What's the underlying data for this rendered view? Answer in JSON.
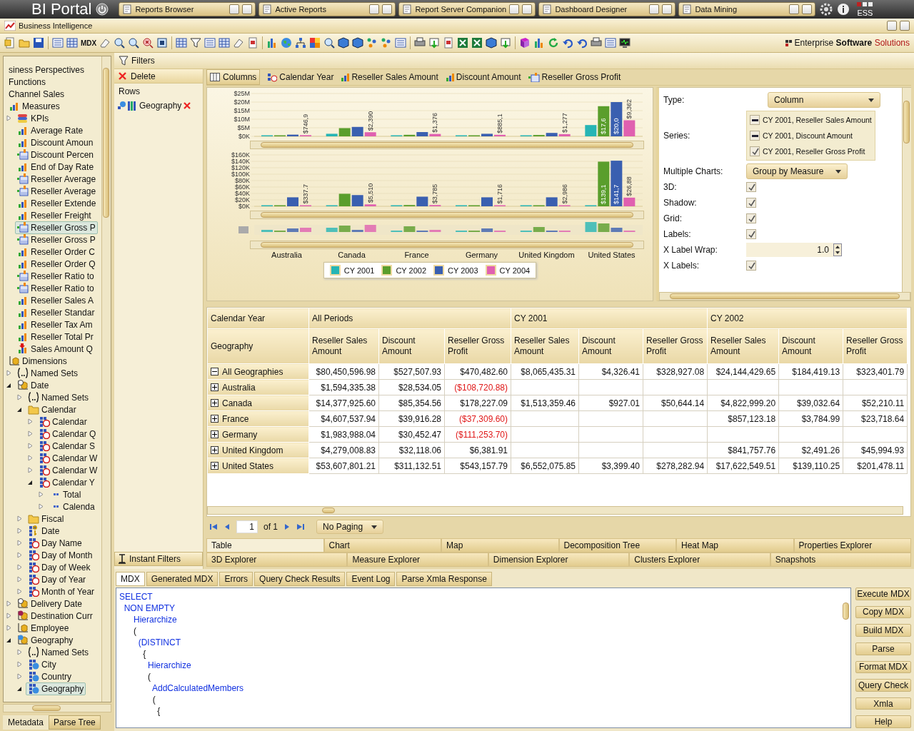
{
  "app_bar": {
    "title": "BI Portal",
    "logo": "ESS",
    "tabs": [
      {
        "label": "Reports Browser",
        "selected": false
      },
      {
        "label": "Active Reports",
        "selected": false
      },
      {
        "label": "Report Server Companion",
        "selected": false
      },
      {
        "label": "Dashboard Designer",
        "selected": false
      },
      {
        "label": "Data Mining",
        "selected": false
      }
    ]
  },
  "module": {
    "title": "Business Intelligence"
  },
  "toolbar": {
    "text_button": "MDX"
  },
  "tagline": [
    "Enterprise",
    "Software",
    "Solutions"
  ],
  "tree": [
    {
      "label": "siness Perspectives",
      "kind": "plain",
      "selected": false
    },
    {
      "label": "Functions",
      "kind": "plain",
      "selected": false
    },
    {
      "label": "Channel Sales",
      "kind": "plain",
      "selected": false
    },
    {
      "label": "Measures",
      "kind": "measures",
      "selected": false,
      "children": [
        {
          "label": "KPIs",
          "kind": "kpi",
          "selected": false,
          "expanded": false
        },
        {
          "label": "Average Rate",
          "kind": "measure",
          "selected": false
        },
        {
          "label": "Discount Amoun",
          "kind": "measure",
          "selected": false
        },
        {
          "label": "Discount Percen",
          "kind": "calc",
          "selected": false
        },
        {
          "label": "End of Day Rate",
          "kind": "measure",
          "selected": false
        },
        {
          "label": "Reseller Average",
          "kind": "calc",
          "selected": false
        },
        {
          "label": "Reseller Average",
          "kind": "calc",
          "selected": false
        },
        {
          "label": "Reseller Extende",
          "kind": "measure",
          "selected": false
        },
        {
          "label": "Reseller Freight",
          "kind": "measure",
          "selected": false
        },
        {
          "label": "Reseller Gross P",
          "kind": "calc",
          "selected": true
        },
        {
          "label": "Reseller Gross P",
          "kind": "calc",
          "selected": false
        },
        {
          "label": "Reseller Order C",
          "kind": "measure",
          "selected": false
        },
        {
          "label": "Reseller Order Q",
          "kind": "measure",
          "selected": false
        },
        {
          "label": "Reseller Ratio to",
          "kind": "calc",
          "selected": false
        },
        {
          "label": "Reseller Ratio to",
          "kind": "calc",
          "selected": false
        },
        {
          "label": "Reseller Sales A",
          "kind": "measure",
          "selected": false
        },
        {
          "label": "Reseller Standar",
          "kind": "measure",
          "selected": false
        },
        {
          "label": "Reseller Tax Am",
          "kind": "measure",
          "selected": false
        },
        {
          "label": "Reseller Total Pr",
          "kind": "measure",
          "selected": false
        },
        {
          "label": "Sales Amount Q",
          "kind": "alert",
          "selected": false
        }
      ]
    },
    {
      "label": "Dimensions",
      "kind": "dimension",
      "selected": false,
      "children": [
        {
          "label": "Named Sets",
          "kind": "set",
          "selected": false,
          "expanded": false
        },
        {
          "label": "Date",
          "kind": "timedim",
          "selected": false,
          "expanded": true,
          "children": [
            {
              "label": "Named Sets",
              "kind": "set",
              "selected": false,
              "expanded": false
            },
            {
              "label": "Calendar",
              "kind": "folder",
              "selected": false,
              "expanded": true,
              "children": [
                {
                  "label": "Calendar",
                  "kind": "timehier",
                  "selected": false,
                  "expanded": false
                },
                {
                  "label": "Calendar Q",
                  "kind": "timehier",
                  "selected": false,
                  "expanded": false
                },
                {
                  "label": "Calendar S",
                  "kind": "timehier",
                  "selected": false,
                  "expanded": false
                },
                {
                  "label": "Calendar W",
                  "kind": "timehier",
                  "selected": false,
                  "expanded": false
                },
                {
                  "label": "Calendar W",
                  "kind": "timehier",
                  "selected": false,
                  "expanded": false
                },
                {
                  "label": "Calendar Y",
                  "kind": "timehier",
                  "selected": false,
                  "expanded": true,
                  "children": [
                    {
                      "label": "Total",
                      "kind": "level",
                      "selected": false,
                      "expanded": false
                    },
                    {
                      "label": "Calenda",
                      "kind": "level",
                      "selected": false,
                      "expanded": false
                    }
                  ]
                }
              ]
            },
            {
              "label": "Fiscal",
              "kind": "folder",
              "selected": false,
              "expanded": false
            },
            {
              "label": "Date",
              "kind": "key",
              "selected": false,
              "expanded": false
            },
            {
              "label": "Day Name",
              "kind": "timehier",
              "selected": false,
              "expanded": false
            },
            {
              "label": "Day of Month",
              "kind": "timehier",
              "selected": false,
              "expanded": false
            },
            {
              "label": "Day of Week",
              "kind": "timehier",
              "selected": false,
              "expanded": false
            },
            {
              "label": "Day of Year",
              "kind": "timehier",
              "selected": false,
              "expanded": false
            },
            {
              "label": "Month of Year",
              "kind": "timehier",
              "selected": false,
              "expanded": false
            }
          ]
        },
        {
          "label": "Delivery Date",
          "kind": "timedim",
          "selected": false,
          "expanded": false
        },
        {
          "label": "Destination Curr",
          "kind": "currencydim",
          "selected": false,
          "expanded": false
        },
        {
          "label": "Employee",
          "kind": "dimension",
          "selected": false,
          "expanded": false
        },
        {
          "label": "Geography",
          "kind": "geodim",
          "selected": false,
          "expanded": true,
          "children": [
            {
              "label": "Named Sets",
              "kind": "set",
              "selected": false,
              "expanded": false
            },
            {
              "label": "City",
              "kind": "geo",
              "selected": false,
              "expanded": false
            },
            {
              "label": "Country",
              "kind": "geo",
              "selected": false,
              "expanded": false
            },
            {
              "label": "Geography",
              "kind": "geo",
              "selected": true,
              "expanded": true
            }
          ]
        }
      ]
    }
  ],
  "left_tabs": [
    {
      "label": "Metadata",
      "selected": true
    },
    {
      "label": "Parse Tree",
      "selected": false
    }
  ],
  "filters": {
    "title": "Filters",
    "delete": "Delete",
    "rows_title": "Rows",
    "rows": [
      {
        "label": "Geography"
      }
    ],
    "instant_filters": "Instant Filters"
  },
  "columns": {
    "title": "Columns",
    "items": [
      {
        "label": "Calendar Year",
        "kind": "dimension"
      },
      {
        "label": "Reseller Sales Amount",
        "kind": "measure"
      },
      {
        "label": "Discount Amount",
        "kind": "measure"
      },
      {
        "label": "Reseller Gross Profit",
        "kind": "calc"
      }
    ]
  },
  "charts": [
    {
      "chart_data": {
        "type": "bar",
        "grid": true,
        "ylim": [
          0,
          25
        ],
        "yticks": [
          {
            "value": 25,
            "label": "$25M"
          },
          {
            "value": 20,
            "label": "$20M"
          },
          {
            "value": 15,
            "label": "$15M"
          },
          {
            "value": 10,
            "label": "$10M"
          },
          {
            "value": 5,
            "label": "$5M"
          },
          {
            "value": 0,
            "label": "$0K"
          }
        ],
        "series": [
          {
            "color": "#26b5b5",
            "values": [
              0,
              1.5,
              0,
              0,
              0,
              6.6
            ]
          },
          {
            "color": "#5a9e2c",
            "values": [
              0,
              4.8,
              0.9,
              0,
              0.8,
              17.6
            ]
          },
          {
            "color": "#3a5fb0",
            "values": [
              1,
              5.5,
              2.5,
              1.5,
              2,
              20
            ]
          },
          {
            "color": "#e060b0",
            "values": [
              0.7,
              2.4,
              1.4,
              0.9,
              1.3,
              9.4
            ]
          }
        ],
        "annotations": [
          "$746,9",
          "$2,390",
          "$1,376",
          "$885,1",
          "$1,277",
          "$9,362",
          "$17,6",
          "$20,0"
        ]
      }
    },
    {
      "chart_data": {
        "type": "bar",
        "grid": true,
        "categories": [
          "Australia",
          "Canada",
          "France",
          "Germany",
          "United Kingdom",
          "United States"
        ],
        "ylim": [
          0,
          160
        ],
        "yticks": [
          {
            "value": 160,
            "label": "$160K"
          },
          {
            "value": 140,
            "label": "$140K"
          },
          {
            "value": 120,
            "label": "$120K"
          },
          {
            "value": 100,
            "label": "$100K"
          },
          {
            "value": 80,
            "label": "$80K"
          },
          {
            "value": 60,
            "label": "$60K"
          },
          {
            "value": 40,
            "label": "$40K"
          },
          {
            "value": 20,
            "label": "$20K"
          },
          {
            "value": 0,
            "label": "$0K"
          }
        ],
        "series": [
          {
            "name": "CY 2001",
            "color": "#26b5b5",
            "values": [
              0,
              1,
              0,
              0,
              0,
              3
            ]
          },
          {
            "name": "CY 2002",
            "color": "#5a9e2c",
            "values": [
              0,
              39,
              4,
              0,
              3,
              139
            ]
          },
          {
            "name": "CY 2003",
            "color": "#3a5fb0",
            "values": [
              28,
              35,
              30,
              28,
              28,
              142
            ]
          },
          {
            "name": "CY 2004",
            "color": "#e060b0",
            "values": [
              0,
              6,
              4,
              2,
              3,
              27
            ]
          }
        ],
        "legend": "bottom",
        "annotations": [
          "$337.7",
          "$5,510",
          "$3,785",
          "$1,716",
          "$2,986",
          "$26,88",
          "$139,1",
          "$141,7"
        ]
      }
    }
  ],
  "properties": {
    "type_label": "Type:",
    "type_value": "Column",
    "series_label": "Series:",
    "series": [
      {
        "label": "CY 2001, Reseller Sales Amount",
        "checked": false,
        "indeterminate": true
      },
      {
        "label": "CY 2001, Discount Amount",
        "checked": false,
        "indeterminate": true
      },
      {
        "label": "CY 2001, Reseller Gross Profit",
        "checked": true,
        "indeterminate": false
      }
    ],
    "multiple_label": "Multiple Charts:",
    "multiple_value": "Group by Measure",
    "options": [
      {
        "label": "3D:",
        "checked": true
      },
      {
        "label": "Shadow:",
        "checked": true
      },
      {
        "label": "Grid:",
        "checked": true
      },
      {
        "label": "Labels:",
        "checked": true
      }
    ],
    "wrap_label": "X Label Wrap:",
    "wrap_value": "1.0",
    "xlabels_label": "X Labels:",
    "xlabels_checked": true
  },
  "grid": {
    "column_header": "Calendar Year",
    "row_header": "Geography",
    "groups": [
      "All Periods",
      "CY 2001",
      "CY 2002"
    ],
    "measures": [
      "Reseller Sales Amount",
      "Discount Amount",
      "Reseller Gross Profit",
      "Reseller Sales Amount",
      "Discount Amount",
      "Reseller Gross Profit",
      "Reseller Sales Amount",
      "Discount Amount",
      "Reseller Gross Profit"
    ],
    "rows": [
      {
        "label": "All Geographies",
        "expanded": true,
        "cells": [
          {
            "text": "$80,450,596.98",
            "negative": false
          },
          {
            "text": "$527,507.93",
            "negative": false
          },
          {
            "text": "$470,482.60",
            "negative": false
          },
          {
            "text": "$8,065,435.31",
            "negative": false
          },
          {
            "text": "$4,326.41",
            "negative": false
          },
          {
            "text": "$328,927.08",
            "negative": false
          },
          {
            "text": "$24,144,429.65",
            "negative": false
          },
          {
            "text": "$184,419.13",
            "negative": false
          },
          {
            "text": "$323,401.79",
            "negative": false
          }
        ]
      },
      {
        "label": "Australia",
        "expanded": false,
        "cells": [
          {
            "text": "$1,594,335.38",
            "negative": false
          },
          {
            "text": "$28,534.05",
            "negative": false
          },
          {
            "text": "($108,720.88)",
            "negative": true
          },
          null,
          null,
          null,
          null,
          null,
          null
        ]
      },
      {
        "label": "Canada",
        "expanded": false,
        "cells": [
          {
            "text": "$14,377,925.60",
            "negative": false
          },
          {
            "text": "$85,354.56",
            "negative": false
          },
          {
            "text": "$178,227.09",
            "negative": false
          },
          {
            "text": "$1,513,359.46",
            "negative": false
          },
          {
            "text": "$927.01",
            "negative": false
          },
          {
            "text": "$50,644.14",
            "negative": false
          },
          {
            "text": "$4,822,999.20",
            "negative": false
          },
          {
            "text": "$39,032.64",
            "negative": false
          },
          {
            "text": "$52,210.11",
            "negative": false
          }
        ]
      },
      {
        "label": "France",
        "expanded": false,
        "cells": [
          {
            "text": "$4,607,537.94",
            "negative": false
          },
          {
            "text": "$39,916.28",
            "negative": false
          },
          {
            "text": "($37,309.60)",
            "negative": true
          },
          null,
          null,
          null,
          {
            "text": "$857,123.18",
            "negative": false
          },
          {
            "text": "$3,784.99",
            "negative": false
          },
          {
            "text": "$23,718.64",
            "negative": false
          }
        ]
      },
      {
        "label": "Germany",
        "expanded": false,
        "cells": [
          {
            "text": "$1,983,988.04",
            "negative": false
          },
          {
            "text": "$30,452.47",
            "negative": false
          },
          {
            "text": "($111,253.70)",
            "negative": true
          },
          null,
          null,
          null,
          null,
          null,
          null
        ]
      },
      {
        "label": "United Kingdom",
        "expanded": false,
        "cells": [
          {
            "text": "$4,279,008.83",
            "negative": false
          },
          {
            "text": "$32,118.06",
            "negative": false
          },
          {
            "text": "$6,381.91",
            "negative": false
          },
          null,
          null,
          null,
          {
            "text": "$841,757.76",
            "negative": false
          },
          {
            "text": "$2,491.26",
            "negative": false
          },
          {
            "text": "$45,994.93",
            "negative": false
          }
        ]
      },
      {
        "label": "United States",
        "expanded": false,
        "cells": [
          {
            "text": "$53,607,801.21",
            "negative": false
          },
          {
            "text": "$311,132.51",
            "negative": false
          },
          {
            "text": "$543,157.79",
            "negative": false
          },
          {
            "text": "$6,552,075.85",
            "negative": false
          },
          {
            "text": "$3,399.40",
            "negative": false
          },
          {
            "text": "$278,282.94",
            "negative": false
          },
          {
            "text": "$17,622,549.51",
            "negative": false
          },
          {
            "text": "$139,110.25",
            "negative": false
          },
          {
            "text": "$201,478.11",
            "negative": false
          }
        ]
      }
    ]
  },
  "pager": {
    "page": "1",
    "of": "of 1",
    "paging": "No Paging"
  },
  "view_tabs": [
    [
      {
        "label": "Table",
        "selected": true
      },
      {
        "label": "Chart",
        "selected": false
      },
      {
        "label": "Map",
        "selected": false
      },
      {
        "label": "Decomposition Tree",
        "selected": false
      },
      {
        "label": "Heat Map",
        "selected": false
      },
      {
        "label": "Properties Explorer",
        "selected": false
      }
    ],
    [
      {
        "label": "3D Explorer",
        "selected": false
      },
      {
        "label": "Measure Explorer",
        "selected": false
      },
      {
        "label": "Dimension Explorer",
        "selected": false
      },
      {
        "label": "Clusters Explorer",
        "selected": false
      },
      {
        "label": "Snapshots",
        "selected": false
      }
    ]
  ],
  "bottom_tabs": [
    {
      "label": "MDX",
      "selected": true
    },
    {
      "label": "Generated MDX",
      "selected": false
    },
    {
      "label": "Errors",
      "selected": false
    },
    {
      "label": "Query Check Results",
      "selected": false
    },
    {
      "label": "Event Log",
      "selected": false
    },
    {
      "label": "Parse Xmla Response",
      "selected": false
    }
  ],
  "mdx": [
    {
      "text": "SELECT",
      "kind": "keyword"
    },
    {
      "text": "  NON EMPTY",
      "kind": "keyword"
    },
    {
      "text": "      Hierarchize",
      "kind": "keyword"
    },
    {
      "text": "      (",
      "kind": "plain"
    },
    {
      "text": "        (DISTINCT",
      "kind": "keyword"
    },
    {
      "text": "          {",
      "kind": "plain"
    },
    {
      "text": "            Hierarchize",
      "kind": "keyword"
    },
    {
      "text": "            (",
      "kind": "plain"
    },
    {
      "text": "              AddCalculatedMembers",
      "kind": "keyword"
    },
    {
      "text": "              (",
      "kind": "plain"
    },
    {
      "text": "                {",
      "kind": "plain"
    }
  ],
  "actions": [
    "Execute MDX",
    "Copy MDX",
    "Build MDX",
    "Parse",
    "Format MDX",
    "Query Check",
    "Xmla",
    "Help"
  ]
}
